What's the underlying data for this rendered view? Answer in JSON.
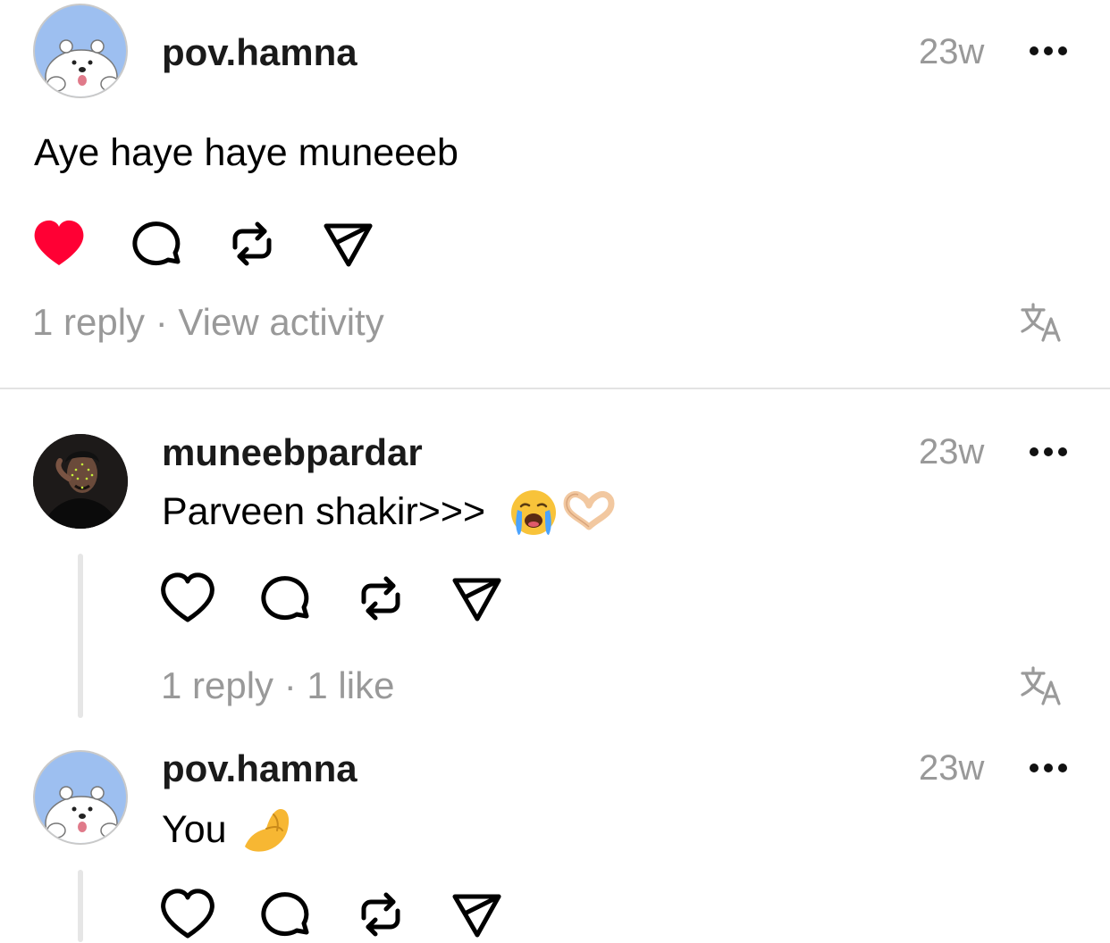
{
  "posts": [
    {
      "username": "pov.hamna",
      "time": "23w",
      "text": "Aye haye haye muneeeb",
      "liked": true,
      "replies": "1 reply",
      "separator": "·",
      "activity": "View activity"
    },
    {
      "username": "muneebpardar",
      "time": "23w",
      "text": "Parveen shakir>>>",
      "emojis": [
        "loudly-crying-face",
        "heart-hands"
      ],
      "liked": false,
      "replies": "1 reply",
      "separator": "·",
      "likes": "1 like"
    },
    {
      "username": "pov.hamna",
      "time": "23w",
      "text": "You",
      "emojis": [
        "pinched-fingers"
      ],
      "liked": false
    }
  ],
  "icons": {
    "like": "heart-icon",
    "comment": "comment-bubble-icon",
    "repost": "repost-icon",
    "share": "send-icon",
    "translate": "translate-icon",
    "more": "more-dots-icon"
  },
  "colors": {
    "liked_heart": "#ff0034",
    "muted_text": "#999999",
    "avatar_bear_bg": "#9dbff0"
  }
}
